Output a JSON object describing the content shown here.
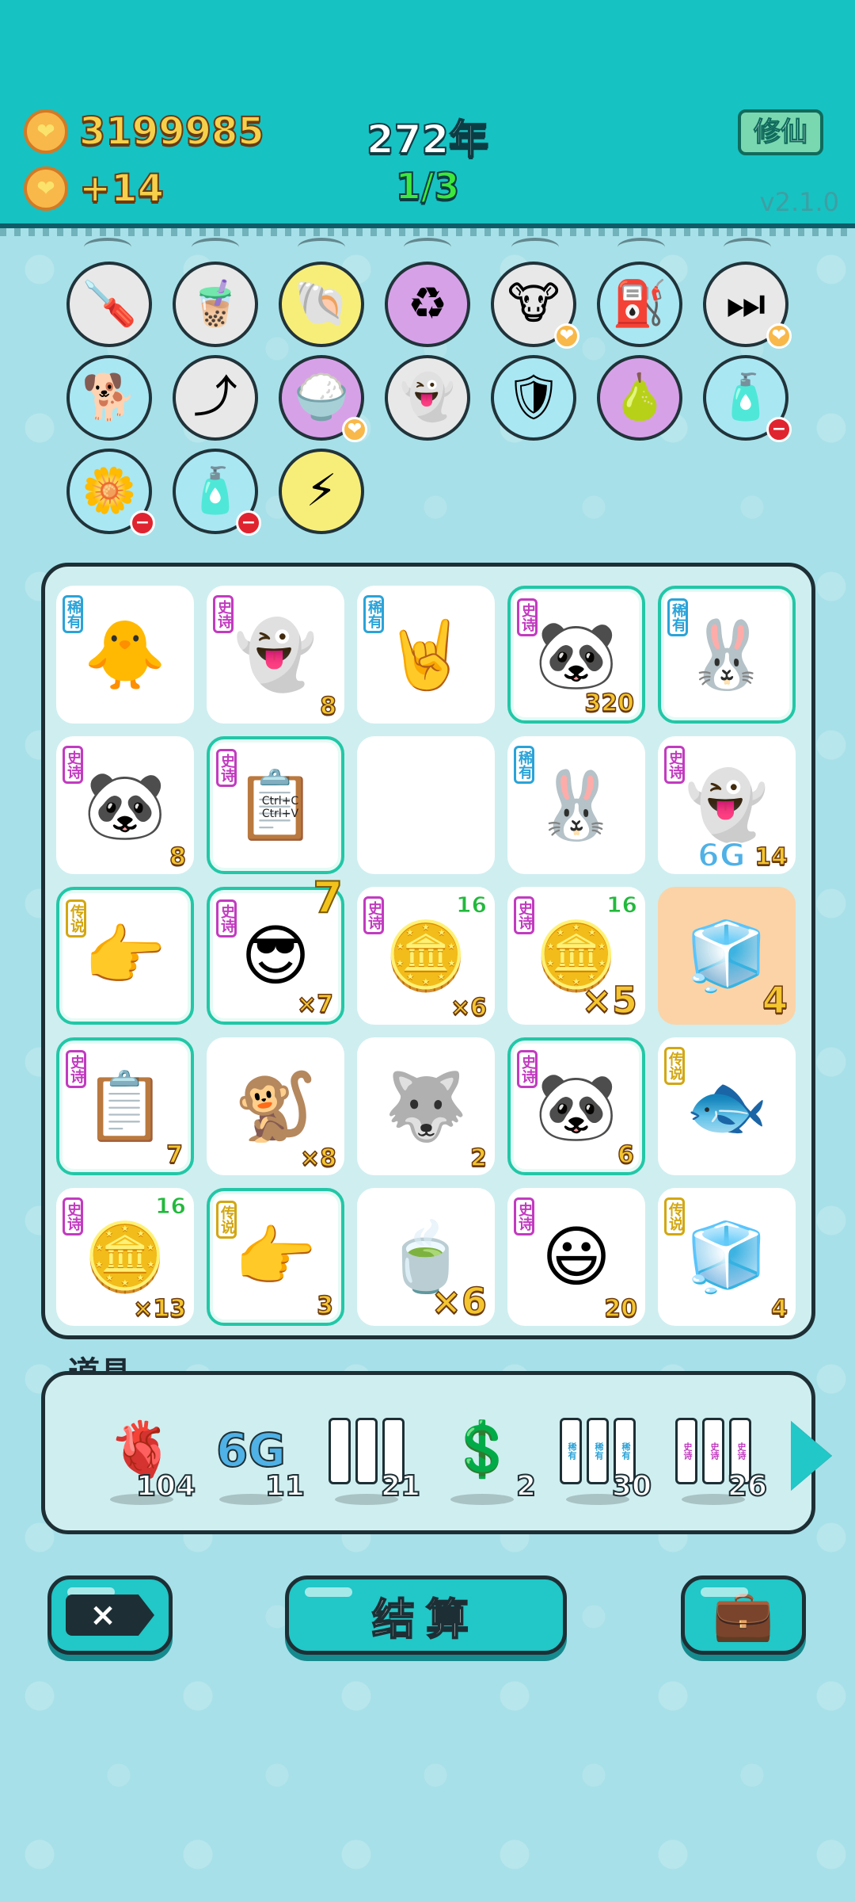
{
  "header": {
    "coins": "3199985",
    "income": "+14",
    "year": "272年",
    "round": "1/3",
    "xiuxian_label": "修仙",
    "version": "v2.1.0"
  },
  "colors": {
    "header_bg": "#17c2c2",
    "page_bg": "#a7e0e8",
    "highlight": "#22c7a7",
    "rarity_rare": "#2aa3d8",
    "rarity_epic": "#c23bc0",
    "rarity_legend": "#d2a712"
  },
  "skills": [
    {
      "icon": "screwdriver-icon",
      "glyph": "🪛",
      "bg": "#e8e8e8"
    },
    {
      "icon": "milk-tea-icon",
      "glyph": "🧋",
      "bg": "#e8e8e8"
    },
    {
      "icon": "shell-icon",
      "glyph": "🐚",
      "bg": "#f7ee7a"
    },
    {
      "icon": "recycle-icon",
      "glyph": "♻",
      "bg": "#d7a1e8"
    },
    {
      "icon": "cows-icon",
      "glyph": "🐮",
      "bg": "#e8e8e8",
      "badge": "heart"
    },
    {
      "icon": "pump-icon",
      "glyph": "⛽",
      "bg": "#a9e7f3"
    },
    {
      "icon": "skip-icon",
      "glyph": "⏭",
      "bg": "#e8e8e8",
      "badge": "heart"
    },
    {
      "icon": "cool-dog-icon",
      "glyph": "🐕",
      "bg": "#a9e7f3"
    },
    {
      "icon": "upgrade-arrow-icon",
      "glyph": "⤴",
      "bg": "#e8e8e8"
    },
    {
      "icon": "rice-bowl-icon",
      "glyph": "🍚",
      "bg": "#d7a1e8",
      "badge": "heart"
    },
    {
      "icon": "ghost-wink-icon",
      "glyph": "👻",
      "bg": "#e8e8e8"
    },
    {
      "icon": "shield-wrench-icon",
      "glyph": "🛡",
      "bg": "#a9e7f3"
    },
    {
      "icon": "pomelo-icon",
      "glyph": "🍐",
      "bg": "#d7a1e8"
    },
    {
      "icon": "bag-icon",
      "glyph": "🧴",
      "bg": "#a9e7f3",
      "badge": "minus"
    },
    {
      "icon": "flower-pot-icon",
      "glyph": "🌼",
      "bg": "#a9e7f3",
      "badge": "minus"
    },
    {
      "icon": "bag-icon",
      "glyph": "🧴",
      "bg": "#a9e7f3",
      "badge": "minus"
    },
    {
      "icon": "lightning-icon",
      "glyph": "⚡",
      "bg": "#f7ee7a"
    }
  ],
  "board": {
    "cells": [
      {
        "icon": "chick-icon",
        "glyph": "🐥",
        "rarity": "稀有",
        "rarity_type": "rare",
        "count": ""
      },
      {
        "icon": "ghost-icon",
        "glyph": "👻",
        "rarity": "史诗",
        "rarity_type": "epic",
        "count": "8"
      },
      {
        "icon": "rock-hand-icon",
        "glyph": "🤘",
        "rarity": "稀有",
        "rarity_type": "rare",
        "count": ""
      },
      {
        "icon": "panda-icon",
        "glyph": "🐼",
        "rarity": "史诗",
        "rarity_type": "epic",
        "count": "320",
        "hl": true
      },
      {
        "icon": "rabbit-icon",
        "glyph": "🐰",
        "rarity": "稀有",
        "rarity_type": "rare",
        "count": "",
        "hl": true
      },
      {
        "icon": "panda-icon",
        "glyph": "🐼",
        "rarity": "史诗",
        "rarity_type": "epic",
        "count": "8"
      },
      {
        "icon": "copy-paste-icon",
        "glyph": "📋",
        "rarity": "史诗",
        "rarity_type": "epic",
        "count": "",
        "hl": true,
        "caption": "Ctrl+C Ctrl+V"
      },
      {
        "icon": "empty-slot",
        "glyph": "",
        "rarity": "",
        "rarity_type": "",
        "count": ""
      },
      {
        "icon": "rabbit-icon",
        "glyph": "🐰",
        "rarity": "稀有",
        "rarity_type": "rare",
        "count": ""
      },
      {
        "icon": "ghost-icon",
        "glyph": "👻",
        "rarity": "史诗",
        "rarity_type": "epic",
        "count": "14",
        "sixg": "6G"
      },
      {
        "icon": "pointing-hand-icon",
        "glyph": "👉",
        "rarity": "传说",
        "rarity_type": "legend",
        "count": "",
        "hl": true
      },
      {
        "icon": "cool-guy-icon",
        "glyph": "😎",
        "rarity": "史诗",
        "rarity_type": "epic",
        "count": "×7",
        "hl": true,
        "effect": "7"
      },
      {
        "icon": "coin-pie-icon",
        "glyph": "🪙",
        "rarity": "史诗",
        "rarity_type": "epic",
        "count": "×6",
        "tag": "16"
      },
      {
        "icon": "coin-pie-icon",
        "glyph": "🪙",
        "rarity": "史诗",
        "rarity_type": "epic",
        "count": "×5",
        "tag": "16",
        "big": true
      },
      {
        "icon": "fridge-icon",
        "glyph": "🧊",
        "rarity": "",
        "rarity_type": "",
        "count": "4",
        "orange": true,
        "big": true
      },
      {
        "icon": "copy-paste-icon",
        "glyph": "📋",
        "rarity": "史诗",
        "rarity_type": "epic",
        "count": "7",
        "hl": true
      },
      {
        "icon": "monkey-icon",
        "glyph": "🐒",
        "rarity": "",
        "rarity_type": "",
        "count": "×8"
      },
      {
        "icon": "husky-icon",
        "glyph": "🐺",
        "rarity": "",
        "rarity_type": "",
        "count": "2"
      },
      {
        "icon": "panda-icon",
        "glyph": "🐼",
        "rarity": "史诗",
        "rarity_type": "epic",
        "count": "6",
        "hl": true
      },
      {
        "icon": "koi-fish-icon",
        "glyph": "🐟",
        "rarity": "传说",
        "rarity_type": "legend",
        "count": ""
      },
      {
        "icon": "coin-pie-icon",
        "glyph": "🪙",
        "rarity": "史诗",
        "rarity_type": "epic",
        "count": "×13",
        "tag": "16"
      },
      {
        "icon": "pointing-hand-icon",
        "glyph": "👉",
        "rarity": "传说",
        "rarity_type": "legend",
        "count": "3",
        "hl": true
      },
      {
        "icon": "tea-bag-icon",
        "glyph": "🍵",
        "rarity": "",
        "rarity_type": "",
        "count": "×6",
        "big": true
      },
      {
        "icon": "smiley-face-icon",
        "glyph": "😃",
        "rarity": "史诗",
        "rarity_type": "epic",
        "count": "20"
      },
      {
        "icon": "fridge-icon",
        "glyph": "🧊",
        "rarity": "传说",
        "rarity_type": "legend",
        "count": "4"
      }
    ]
  },
  "props": {
    "title": "道具",
    "items": [
      {
        "icon": "liver-icon",
        "glyph": "🫀",
        "count": "104"
      },
      {
        "icon": "6g-icon",
        "glyph": "6G",
        "count": "11"
      },
      {
        "icon": "blank-cards-icon",
        "glyph": "",
        "count": "21",
        "cards": [
          "",
          "",
          ""
        ]
      },
      {
        "icon": "coin-icon",
        "glyph": "💲",
        "count": "2"
      },
      {
        "icon": "rare-cards-icon",
        "glyph": "",
        "count": "30",
        "cards": [
          "稀有",
          "稀有",
          "稀有"
        ],
        "card_color": "#2aa3d8"
      },
      {
        "icon": "epic-cards-icon",
        "glyph": "",
        "count": "26",
        "cards": [
          "史诗",
          "史诗",
          "史诗"
        ],
        "card_color": "#c23bc0"
      }
    ]
  },
  "actions": {
    "close_label": "×",
    "settle_label": "结算",
    "bag_glyph": "💼"
  }
}
